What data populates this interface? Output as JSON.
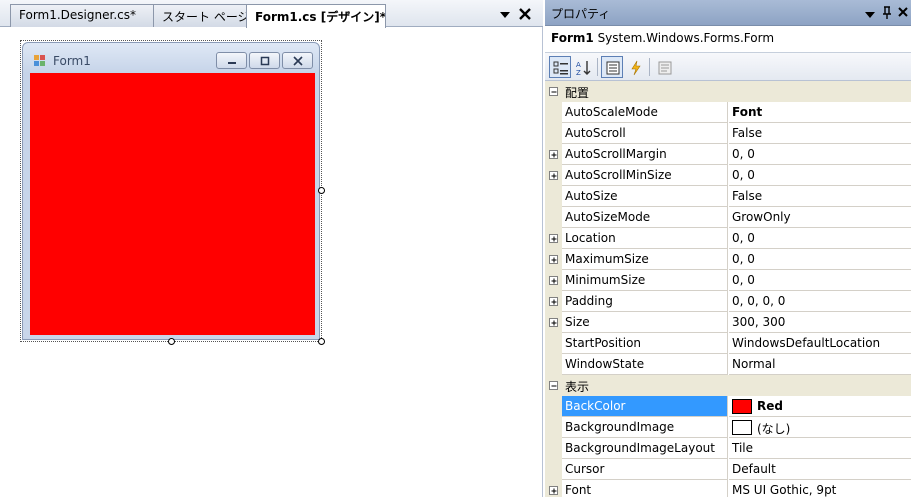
{
  "tabs": [
    {
      "label": "Form1.Designer.cs*"
    },
    {
      "label": "スタート ページ"
    },
    {
      "label": "Form1.cs [デザイン]*"
    }
  ],
  "form": {
    "title": "Form1",
    "client_color": "#ff0000"
  },
  "properties": {
    "title": "プロパティ",
    "object_name": "Form1",
    "object_type": "System.Windows.Forms.Form",
    "categories": {
      "layout": "配置",
      "appearance": "表示"
    },
    "rows": [
      {
        "name": "AutoScaleMode",
        "value": "Font"
      },
      {
        "name": "AutoScroll",
        "value": "False"
      },
      {
        "name": "AutoScrollMargin",
        "value": "0, 0"
      },
      {
        "name": "AutoScrollMinSize",
        "value": "0, 0"
      },
      {
        "name": "AutoSize",
        "value": "False"
      },
      {
        "name": "AutoSizeMode",
        "value": "GrowOnly"
      },
      {
        "name": "Location",
        "value": "0, 0"
      },
      {
        "name": "MaximumSize",
        "value": "0, 0"
      },
      {
        "name": "MinimumSize",
        "value": "0, 0"
      },
      {
        "name": "Padding",
        "value": "0, 0, 0, 0"
      },
      {
        "name": "Size",
        "value": "300, 300"
      },
      {
        "name": "StartPosition",
        "value": "WindowsDefaultLocation"
      },
      {
        "name": "WindowState",
        "value": "Normal"
      },
      {
        "name": "BackColor",
        "value": "Red"
      },
      {
        "name": "BackgroundImage",
        "value": "(なし)"
      },
      {
        "name": "BackgroundImageLayout",
        "value": "Tile"
      },
      {
        "name": "Cursor",
        "value": "Default"
      },
      {
        "name": "Font",
        "value": "MS UI Gothic, 9pt"
      }
    ],
    "colors": {
      "selected_row": "#3399ff",
      "backcolor_swatch": "#ff0000",
      "background_image_swatch": "#ffffff"
    }
  }
}
